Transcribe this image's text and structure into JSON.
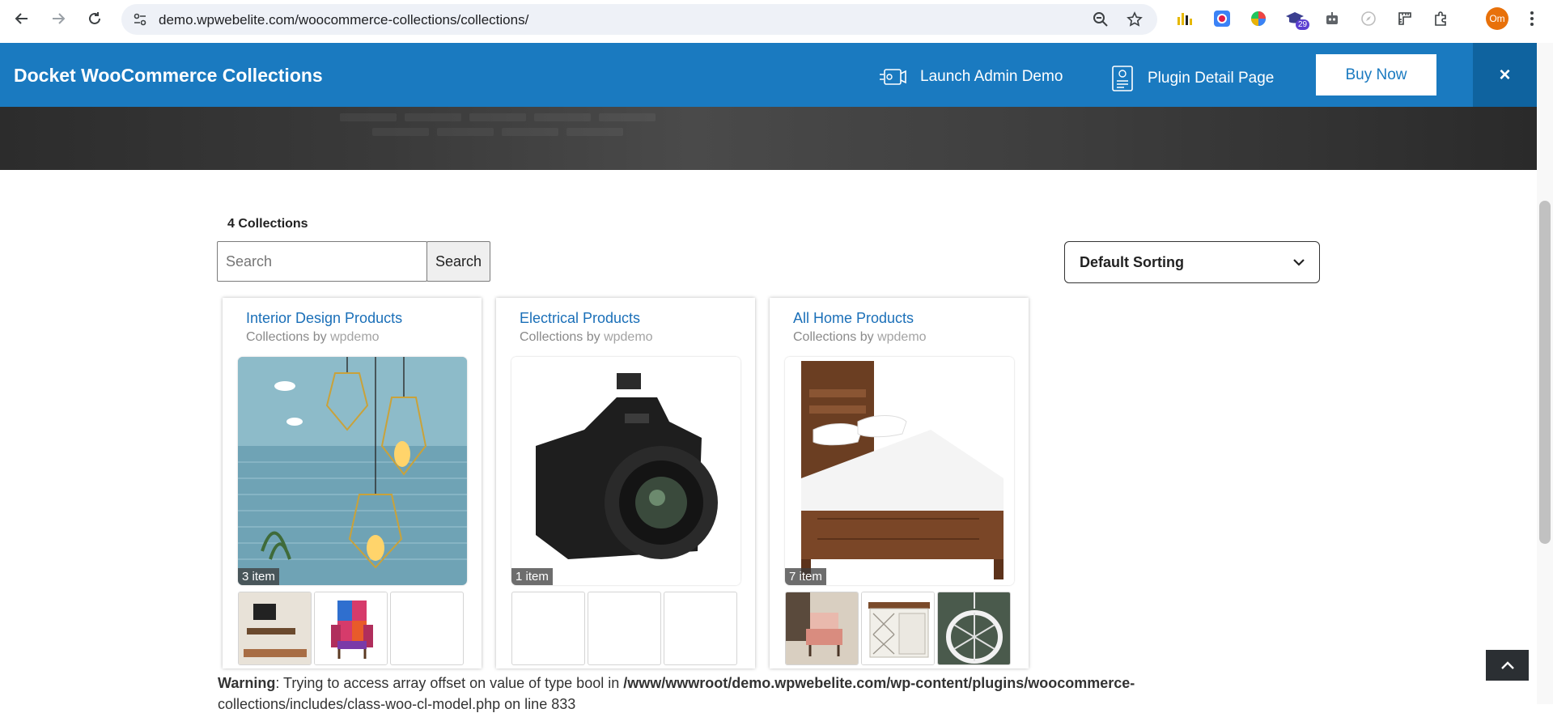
{
  "browser": {
    "url": "demo.wpwebelite.com/woocommerce-collections/collections/",
    "extension_badge": "29",
    "profile_initials": "Om"
  },
  "topbar": {
    "brand": "Docket WooCommerce Collections",
    "launch_admin": "Launch Admin Demo",
    "plugin_detail": "Plugin Detail Page",
    "buy_now": "Buy Now",
    "close_symbol": "×",
    "accent_color": "#1a7ac0"
  },
  "collections": {
    "count_label": "4 Collections",
    "search_placeholder": "Search",
    "search_button": "Search",
    "sort_selected": "Default Sorting",
    "cards": [
      {
        "title": "Interior Design Products",
        "by": "Collections by",
        "author": "wpdemo",
        "items": "3 item",
        "image": "pendant-lamps"
      },
      {
        "title": "Electrical Products",
        "by": "Collections by",
        "author": "wpdemo",
        "items": "1 item",
        "image": "dslr-camera"
      },
      {
        "title": "All Home Products",
        "by": "Collections by",
        "author": "wpdemo",
        "items": "7 item",
        "image": "wooden-bed"
      }
    ]
  },
  "warning": {
    "label": "Warning",
    "message": ": Trying to access array offset on value of type bool in ",
    "path": "/www/wwwroot/demo.wpwebelite.com/wp-content/plugins/woocommerce-",
    "path_cont": "collections/includes/class-woo-cl-model.php",
    "line_text": " on line ",
    "line_no": "833"
  }
}
